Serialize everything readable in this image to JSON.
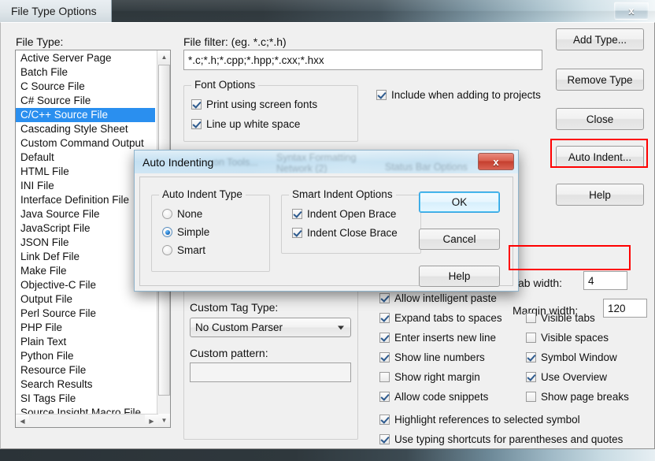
{
  "window": {
    "title": "File Type Options",
    "close_label": "x"
  },
  "labels": {
    "file_type": "File Type:",
    "file_filter": "File filter: (eg. *.c;*.h)",
    "custom_tag_type": "Custom Tag Type:",
    "custom_pattern": "Custom pattern:",
    "tab_width": "Tab width:",
    "margin_width": "Margin width:"
  },
  "file_filter": {
    "value": "*.c;*.h;*.cpp;*.hpp;*.cxx;*.hxx"
  },
  "file_type_list": {
    "selected": "C/C++ Source File",
    "items": [
      "Active Server Page",
      "Batch File",
      "C Source File",
      "C# Source File",
      "C/C++ Source File",
      "Cascading Style Sheet",
      "Custom Command Output",
      "Default",
      "HTML File",
      "INI File",
      "Interface Definition File",
      "Java Source File",
      "JavaScript File",
      "JSON File",
      "Link Def File",
      "Make File",
      "Objective-C File",
      "Output File",
      "Perl Source File",
      "PHP File",
      "Plain Text",
      "Python File",
      "Resource File",
      "Search Results",
      "SI Tags File",
      "Source Insight Macro File"
    ]
  },
  "font_options": {
    "title": "Font Options",
    "print_using_screen_fonts": {
      "label": "Print using screen fonts",
      "checked": true
    },
    "line_up_white_space": {
      "label": "Line up white space",
      "checked": true
    }
  },
  "include_when_adding": {
    "label": "Include when adding to projects",
    "checked": true
  },
  "custom_tag_type": {
    "value": "No Custom Parser"
  },
  "custom_pattern": {
    "value": ""
  },
  "tab_width": {
    "value": "4"
  },
  "margin_width": {
    "value": "120"
  },
  "editor_options_left": [
    {
      "label": "Allow intelligent paste",
      "checked": true
    },
    {
      "label": "Expand tabs to spaces",
      "checked": true
    },
    {
      "label": "Enter inserts new line",
      "checked": true
    },
    {
      "label": "Show line numbers",
      "checked": true
    },
    {
      "label": "Show right margin",
      "checked": false
    },
    {
      "label": "Allow code snippets",
      "checked": true
    }
  ],
  "editor_options_right": [
    {
      "label": "Visible tabs",
      "checked": false
    },
    {
      "label": "Visible spaces",
      "checked": false
    },
    {
      "label": "Symbol Window",
      "checked": true
    },
    {
      "label": "Use Overview",
      "checked": true
    },
    {
      "label": "Show page breaks",
      "checked": false
    }
  ],
  "editor_options_wide": [
    {
      "label": "Highlight references to selected symbol",
      "checked": true
    },
    {
      "label": "Use typing shortcuts for parentheses and quotes",
      "checked": true
    }
  ],
  "side_buttons": [
    {
      "label": "Add Type..."
    },
    {
      "label": "Remove Type"
    },
    {
      "label": "Close"
    },
    {
      "label": "Auto Indent..."
    },
    {
      "label": "Help"
    }
  ],
  "dialog": {
    "title": "Auto Indenting",
    "close_label": "x",
    "ghost_text": [
      "on Tools...",
      "Syntax Formatting",
      "Network (2)",
      "Status Bar Options"
    ],
    "auto_indent_type": {
      "title": "Auto Indent Type",
      "options": [
        {
          "label": "None",
          "selected": false
        },
        {
          "label": "Simple",
          "selected": true
        },
        {
          "label": "Smart",
          "selected": false
        }
      ]
    },
    "smart_indent_options": {
      "title": "Smart Indent Options",
      "items": [
        {
          "label": "Indent Open Brace",
          "checked": true
        },
        {
          "label": "Indent Close Brace",
          "checked": true
        }
      ]
    },
    "buttons": {
      "ok": "OK",
      "cancel": "Cancel",
      "help": "Help"
    }
  },
  "colors": {
    "selection_blue": "#2a8fef",
    "annotation_red": "#ff0000",
    "dialog_glass": "#bcdcf0"
  }
}
